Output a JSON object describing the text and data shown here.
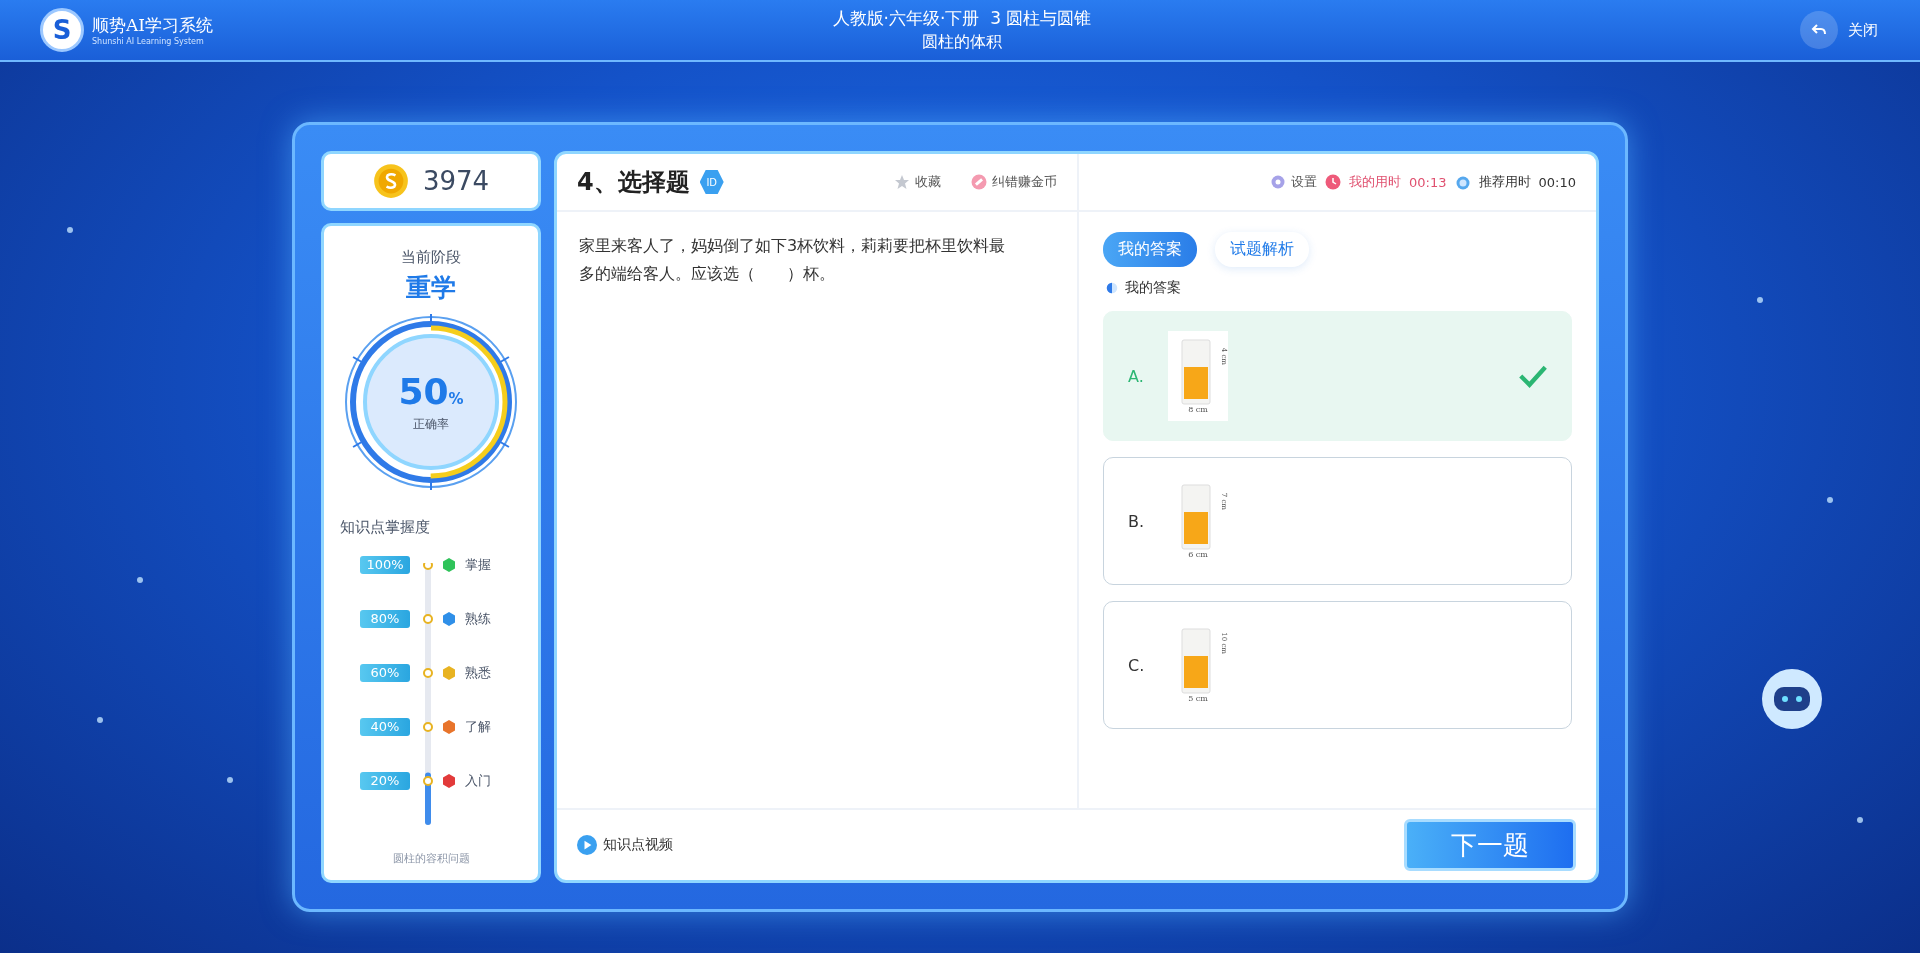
{
  "header": {
    "logo_letter": "S",
    "app_name": "顺势AI学习系统",
    "app_subtitle": "Shunshi AI Learning System",
    "breadcrumb": "人教版·六年级·下册  3 圆柱与圆锥",
    "lesson": "圆柱的体积",
    "close_label": "关闭"
  },
  "coins": "3974",
  "stage": {
    "label": "当前阶段",
    "value": "重学",
    "accuracy": "50",
    "accuracy_unit": "%",
    "accuracy_label": "正确率",
    "level": 0.5
  },
  "mastery": {
    "title": "知识点掌握度",
    "level": 0.2,
    "topic": "圆柱的容积问题",
    "levels": [
      {
        "percent": "100%",
        "name": "掌握",
        "color": "#2fc35a"
      },
      {
        "percent": "80%",
        "name": "熟练",
        "color": "#2f8fe8"
      },
      {
        "percent": "60%",
        "name": "熟悉",
        "color": "#e8b321"
      },
      {
        "percent": "40%",
        "name": "了解",
        "color": "#e8742b"
      },
      {
        "percent": "20%",
        "name": "入门",
        "color": "#e23a3a"
      }
    ]
  },
  "question": {
    "number_title": "4、选择题",
    "id_badge": "ID",
    "favorite": "收藏",
    "report": "纠错赚金币",
    "text": "家里来客人了，妈妈倒了如下3杯饮料，莉莉要把杯里饮料最多的端给客人。应该选（　　）杯。",
    "video_link": "知识点视频"
  },
  "timing": {
    "settings": "设置",
    "my_time_label": "我的用时",
    "my_time": "00:13",
    "recommended_label": "推荐用时",
    "recommended_time": "00:10"
  },
  "answer_tabs": [
    {
      "label": "我的答案",
      "selected": true
    },
    {
      "label": "试题解析",
      "selected": false
    }
  ],
  "answer_heading": "我的答案",
  "options": [
    {
      "letter": "A.",
      "selected": true,
      "correct": true,
      "width_label": "8 cm",
      "height_label": "4 cm"
    },
    {
      "letter": "B.",
      "selected": false,
      "correct": false,
      "width_label": "6 cm",
      "height_label": "7 cm"
    },
    {
      "letter": "C.",
      "selected": false,
      "correct": false,
      "width_label": "5 cm",
      "height_label": "10 cm"
    }
  ],
  "next_button": "下一题"
}
